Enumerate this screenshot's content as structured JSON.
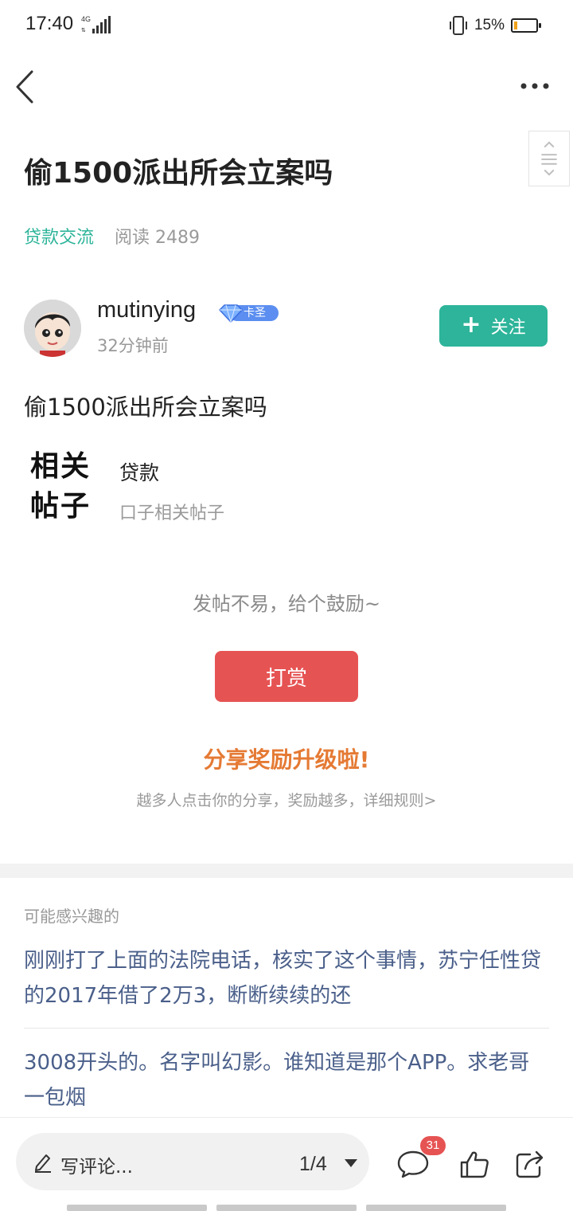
{
  "status": {
    "time": "17:40",
    "network": "4G",
    "battery_percent": "15%",
    "battery_level": 0.15,
    "battery_color": "#f0a11a"
  },
  "nav": {
    "back_icon": "chevron-left-icon",
    "more_icon": "more-dots-icon"
  },
  "post": {
    "title": "偷1500派出所会立案吗",
    "category": "贷款交流",
    "read_count": "阅读 2489",
    "author": {
      "name": "mutinying",
      "badge": "卡圣",
      "time": "32分钟前"
    },
    "follow_label": "关注",
    "body": "偷1500派出所会立案吗",
    "related": {
      "mark_line1": "相关",
      "mark_line2": "帖子",
      "title": "贷款",
      "subtitle": "口子相关帖子"
    }
  },
  "reward": {
    "prompt": "发帖不易，给个鼓励~",
    "button_label": "打赏"
  },
  "share": {
    "title": "分享奖励升级啦!",
    "subtitle": "越多人点击你的分享，奖励越多，详细规则>"
  },
  "interest": {
    "label": "可能感兴趣的",
    "items": [
      {
        "text": "刚刚打了上面的法院电话，核实了这个事情，苏宁任性贷的2017年借了2万3，断断续续的还"
      },
      {
        "text": "3008开头的。名字叫幻影。谁知道是那个APP。求老哥 一包烟"
      }
    ]
  },
  "bottom": {
    "comment_placeholder": "写评论...",
    "page_indicator": "1/4",
    "comment_count": "31"
  },
  "colors": {
    "accent": "#2db49a",
    "reward": "#e65353",
    "share_title": "#e57a34",
    "link": "#4a5f8a"
  }
}
